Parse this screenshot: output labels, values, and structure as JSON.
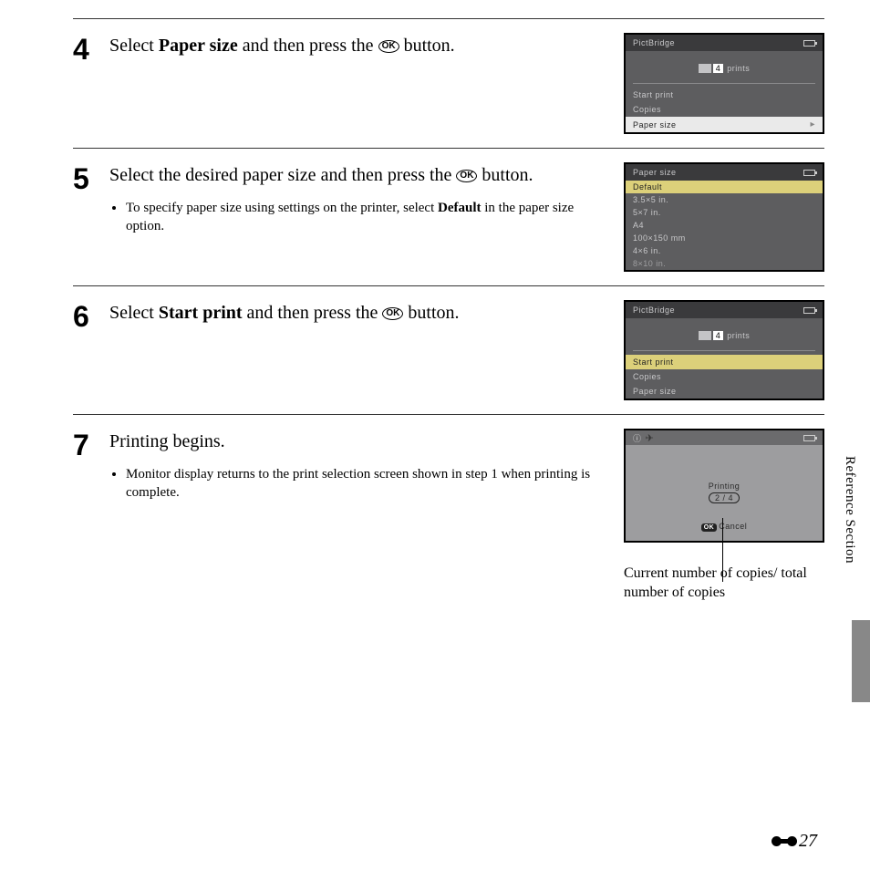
{
  "steps": [
    {
      "num": "4",
      "title_prefix": "Select ",
      "title_bold": "Paper size",
      "title_suffix": " and then press the ",
      "title_after_icon": " button.",
      "screen": {
        "header": "PictBridge",
        "prints_number": "4",
        "prints_label": "prints",
        "menu": [
          "Start print",
          "Copies",
          "Paper size"
        ],
        "selected_index": 2
      }
    },
    {
      "num": "5",
      "title_prefix": "Select the desired paper size and then press the ",
      "title_bold": "",
      "title_after_icon": " button.",
      "bullets": [
        {
          "pre": "To specify paper size using settings on the printer, select ",
          "bold": "Default",
          "post": " in the paper size option."
        }
      ],
      "screen": {
        "header": "Paper size",
        "list": [
          "Default",
          "3.5×5 in.",
          "5×7 in.",
          "A4",
          "100×150 mm",
          "4×6 in.",
          "8×10 in."
        ],
        "selected_index": 0
      }
    },
    {
      "num": "6",
      "title_prefix": "Select ",
      "title_bold": "Start print",
      "title_suffix": " and then press the ",
      "title_after_icon": " button.",
      "screen": {
        "header": "PictBridge",
        "prints_number": "4",
        "prints_label": "prints",
        "menu": [
          "Start print",
          "Copies",
          "Paper size"
        ],
        "selected_index": 0,
        "selected_style": "yellow"
      }
    },
    {
      "num": "7",
      "title_prefix": "Printing begins.",
      "bullets": [
        {
          "pre": "Monitor display returns to the print selection screen shown in step 1 when printing is complete.",
          "bold": "",
          "post": ""
        }
      ],
      "screen": {
        "printing_label": "Printing",
        "progress": "2 / 4",
        "cancel_label": "Cancel"
      },
      "callout": "Current number of copies/ total number of copies"
    }
  ],
  "side_label": "Reference Section",
  "page_number": "27",
  "ok_text": "OK"
}
